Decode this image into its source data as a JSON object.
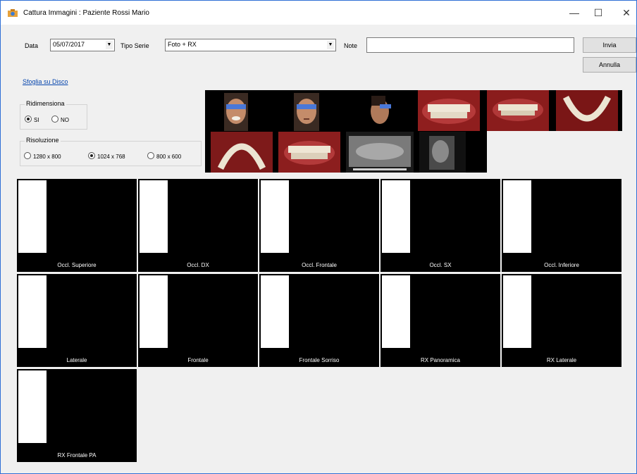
{
  "window": {
    "title": "Cattura Immagini : Paziente Rossi Mario",
    "minimize": "—",
    "maximize": "☐",
    "close": "✕"
  },
  "form": {
    "date_label": "Data",
    "date_value": "05/07/2017",
    "series_label": "Tipo Serie",
    "series_value": "Foto + RX",
    "note_label": "Note",
    "note_value": "",
    "send_button": "Invia",
    "cancel_button": "Annulla",
    "browse_link": "Sfoglia su Disco"
  },
  "resize_group": {
    "legend": "Ridimensiona",
    "options": [
      "SI",
      "NO"
    ],
    "selected": "SI"
  },
  "resolution_group": {
    "legend": "Risoluzione",
    "options": [
      "1280 x 800",
      "1024 x 768",
      "800 x 600"
    ],
    "selected": "1024 x 768"
  },
  "slots": [
    {
      "label": "Occl. Superiore"
    },
    {
      "label": "Occl. DX"
    },
    {
      "label": "Occl. Frontale"
    },
    {
      "label": "Occl. SX"
    },
    {
      "label": "Occl. Inferiore"
    },
    {
      "label": "Laterale"
    },
    {
      "label": "Frontale"
    },
    {
      "label": "Frontale Sorriso"
    },
    {
      "label": "RX Panoramica"
    },
    {
      "label": "RX Laterale"
    },
    {
      "label": "RX Frontale PA"
    }
  ],
  "thumbnails": [
    {
      "name": "frontal-smile-photo"
    },
    {
      "name": "frontal-photo"
    },
    {
      "name": "lateral-photo"
    },
    {
      "name": "occlusal-frontal-photo"
    },
    {
      "name": "occlusal-right-photo"
    },
    {
      "name": "occlusal-lower-photo"
    },
    {
      "name": "occlusal-upper-photo"
    },
    {
      "name": "occlusal-left-photo"
    },
    {
      "name": "panoramic-xray"
    },
    {
      "name": "lateral-xray"
    }
  ]
}
